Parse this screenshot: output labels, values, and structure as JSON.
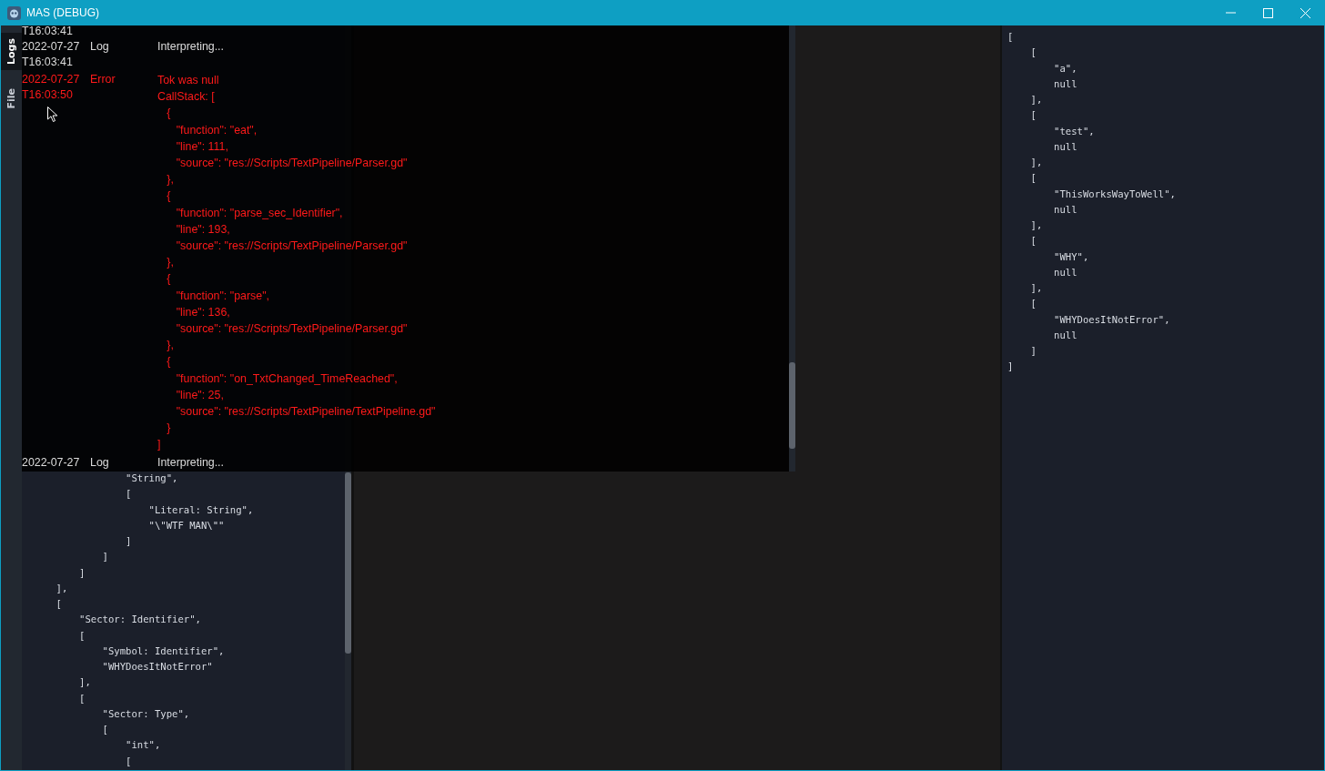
{
  "window": {
    "title": "MAS (DEBUG)"
  },
  "side_tabs": [
    {
      "label": "Logs",
      "selected": true
    },
    {
      "label": "File",
      "selected": false
    }
  ],
  "tree_panel": {
    "lines": [
      "                \"String\",",
      "                [",
      "                    \"Literal: String\",",
      "                    \"\\\"WTF MAN\\\"\"",
      "                ]",
      "            ]",
      "        ]",
      "    ],",
      "    [",
      "        \"Sector: Identifier\",",
      "        [",
      "            \"Symbol: Identifier\",",
      "            \"WHYDoesItNotError\"",
      "        ],",
      "        [",
      "            \"Sector: Type\",",
      "            [",
      "                \"int\",",
      "                ["
    ]
  },
  "output_panel": {
    "lines": [
      "[",
      "    [",
      "        \"a\",",
      "        null",
      "    ],",
      "    [",
      "        \"test\",",
      "        null",
      "    ],",
      "    [",
      "        \"ThisWorksWayToWell\",",
      "        null",
      "    ],",
      "    [",
      "        \"WHY\",",
      "        null",
      "    ],",
      "    [",
      "        \"WHYDoesItNotError\",",
      "        null",
      "    ]",
      "]"
    ]
  },
  "log_overlay": {
    "entries": [
      {
        "time": "T16:03:41"
      },
      {
        "date": "2022-07-27",
        "time": "T16:03:41",
        "kind": "log",
        "level": "Log",
        "message": "Interpreting..."
      },
      {
        "date": "2022-07-27",
        "time": "T16:03:50",
        "kind": "error",
        "level": "Error",
        "message": "Tok was null\nCallStack: [\n   {\n      \"function\": \"eat\",\n      \"line\": 111,\n      \"source\": \"res://Scripts/TextPipeline/Parser.gd\"\n   },\n   {\n      \"function\": \"parse_sec_Identifier\",\n      \"line\": 193,\n      \"source\": \"res://Scripts/TextPipeline/Parser.gd\"\n   },\n   {\n      \"function\": \"parse\",\n      \"line\": 136,\n      \"source\": \"res://Scripts/TextPipeline/Parser.gd\"\n   },\n   {\n      \"function\": \"on_TxtChanged_TimeReached\",\n      \"line\": 25,\n      \"source\": \"res://Scripts/TextPipeline/TextPipeline.gd\"\n   }\n]"
      },
      {
        "date": "2022-07-27",
        "kind": "log",
        "level": "Log",
        "message": "Interpreting..."
      }
    ]
  }
}
